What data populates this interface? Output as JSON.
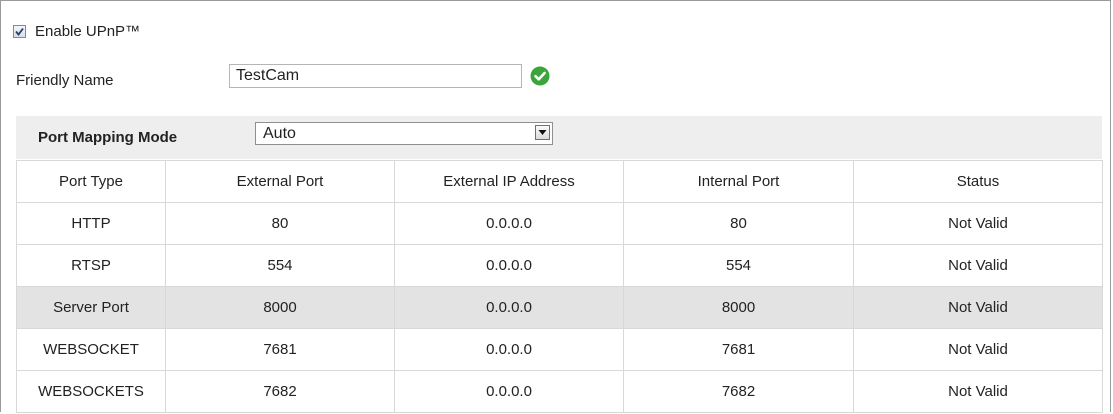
{
  "upnp": {
    "enable_label": "Enable UPnP™",
    "enabled": true
  },
  "friendly": {
    "label": "Friendly Name",
    "value": "TestCam",
    "status_icon": "check-circle-icon",
    "status_color": "#3aa53a"
  },
  "mapping": {
    "label": "Port Mapping Mode",
    "selected": "Auto"
  },
  "table": {
    "headers": [
      "Port Type",
      "External Port",
      "External IP Address",
      "Internal Port",
      "Status"
    ],
    "rows": [
      [
        "HTTP",
        "80",
        "0.0.0.0",
        "80",
        "Not Valid"
      ],
      [
        "RTSP",
        "554",
        "0.0.0.0",
        "554",
        "Not Valid"
      ],
      [
        "Server Port",
        "8000",
        "0.0.0.0",
        "8000",
        "Not Valid"
      ],
      [
        "WEBSOCKET",
        "7681",
        "0.0.0.0",
        "7681",
        "Not Valid"
      ],
      [
        "WEBSOCKETS",
        "7682",
        "0.0.0.0",
        "7682",
        "Not Valid"
      ]
    ]
  }
}
